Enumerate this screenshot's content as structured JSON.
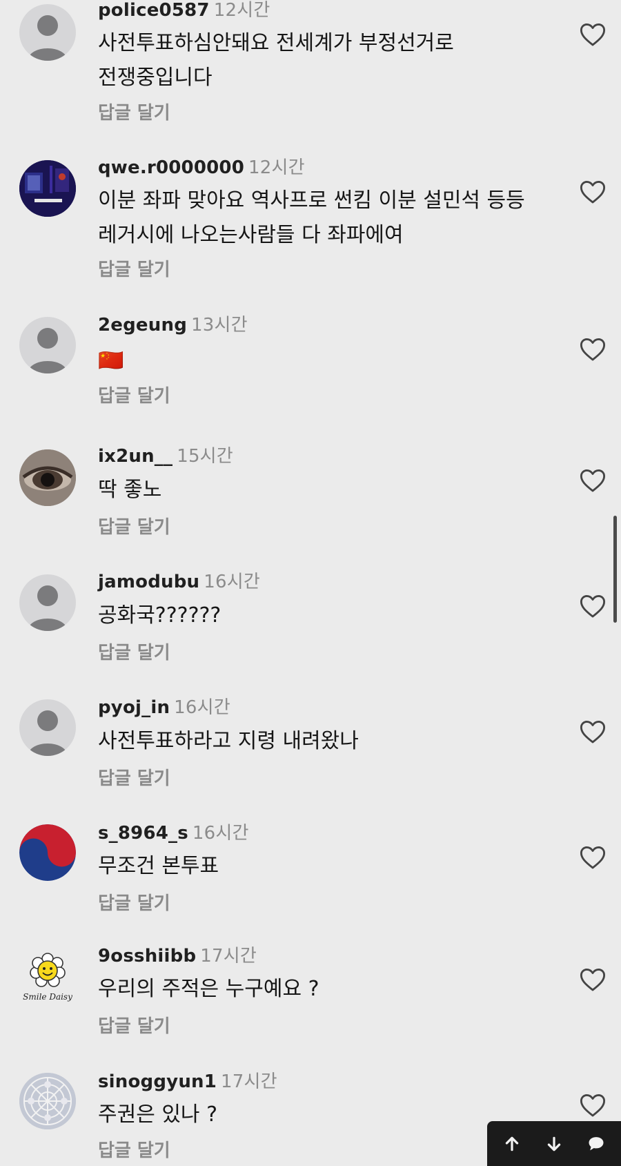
{
  "comments": [
    {
      "username": "police0587",
      "time": "12시간",
      "lines": [
        "사전투표하심안돼요 전세계가 부정선거로",
        "전쟁중입니다"
      ],
      "reply_label": "답글 달기",
      "avatar_icon": "default-avatar-icon"
    },
    {
      "username": "qwe.r0000000",
      "time": "12시간",
      "lines": [
        "이분 좌파 맞아요 역사프로 썬킴 이분 설민석 등등",
        "레거시에 나오는사람들 다 좌파에여"
      ],
      "reply_label": "답글 달기",
      "avatar_icon": "dark-poster-avatar"
    },
    {
      "username": "2egeung",
      "time": "13시간",
      "lines": [
        "🇨🇳"
      ],
      "reply_label": "답글 달기",
      "avatar_icon": "default-avatar-icon"
    },
    {
      "username": "ix2un__",
      "time": "15시간",
      "lines": [
        "딱 좋노"
      ],
      "reply_label": "답글 달기",
      "avatar_icon": "eye-photo-avatar"
    },
    {
      "username": "jamodubu",
      "time": "16시간",
      "lines": [
        "공화국??????"
      ],
      "reply_label": "답글 달기",
      "avatar_icon": "default-avatar-icon"
    },
    {
      "username": "pyoj_in",
      "time": "16시간",
      "lines": [
        "사전투표하라고 지령 내려왔나"
      ],
      "reply_label": "답글 달기",
      "avatar_icon": "default-avatar-icon"
    },
    {
      "username": "s_8964_s",
      "time": "16시간",
      "lines": [
        "무조건 본투표"
      ],
      "reply_label": "답글 달기",
      "avatar_icon": "taegeuk-avatar"
    },
    {
      "username": "9osshiibb",
      "time": "17시간",
      "lines": [
        "우리의 주적은 누구예요 ?"
      ],
      "reply_label": "답글 달기",
      "avatar_icon": "smile-daisy-avatar",
      "avatar_text": "Smile Daisy"
    },
    {
      "username": "sinoggyun1",
      "time": "17시간",
      "lines": [
        "주권은 있나 ?"
      ],
      "reply_label": "답글 달기",
      "avatar_icon": "lace-pattern-avatar"
    }
  ],
  "nav": {
    "up_icon": "arrow-up-icon",
    "down_icon": "arrow-down-icon",
    "comment_icon": "speech-bubble-icon"
  },
  "colors": {
    "background": "#ebebeb",
    "username": "#202020",
    "timestamp": "#8b8b8b",
    "reply": "#8a8a8a",
    "nav_bar": "#1b1b1b"
  }
}
